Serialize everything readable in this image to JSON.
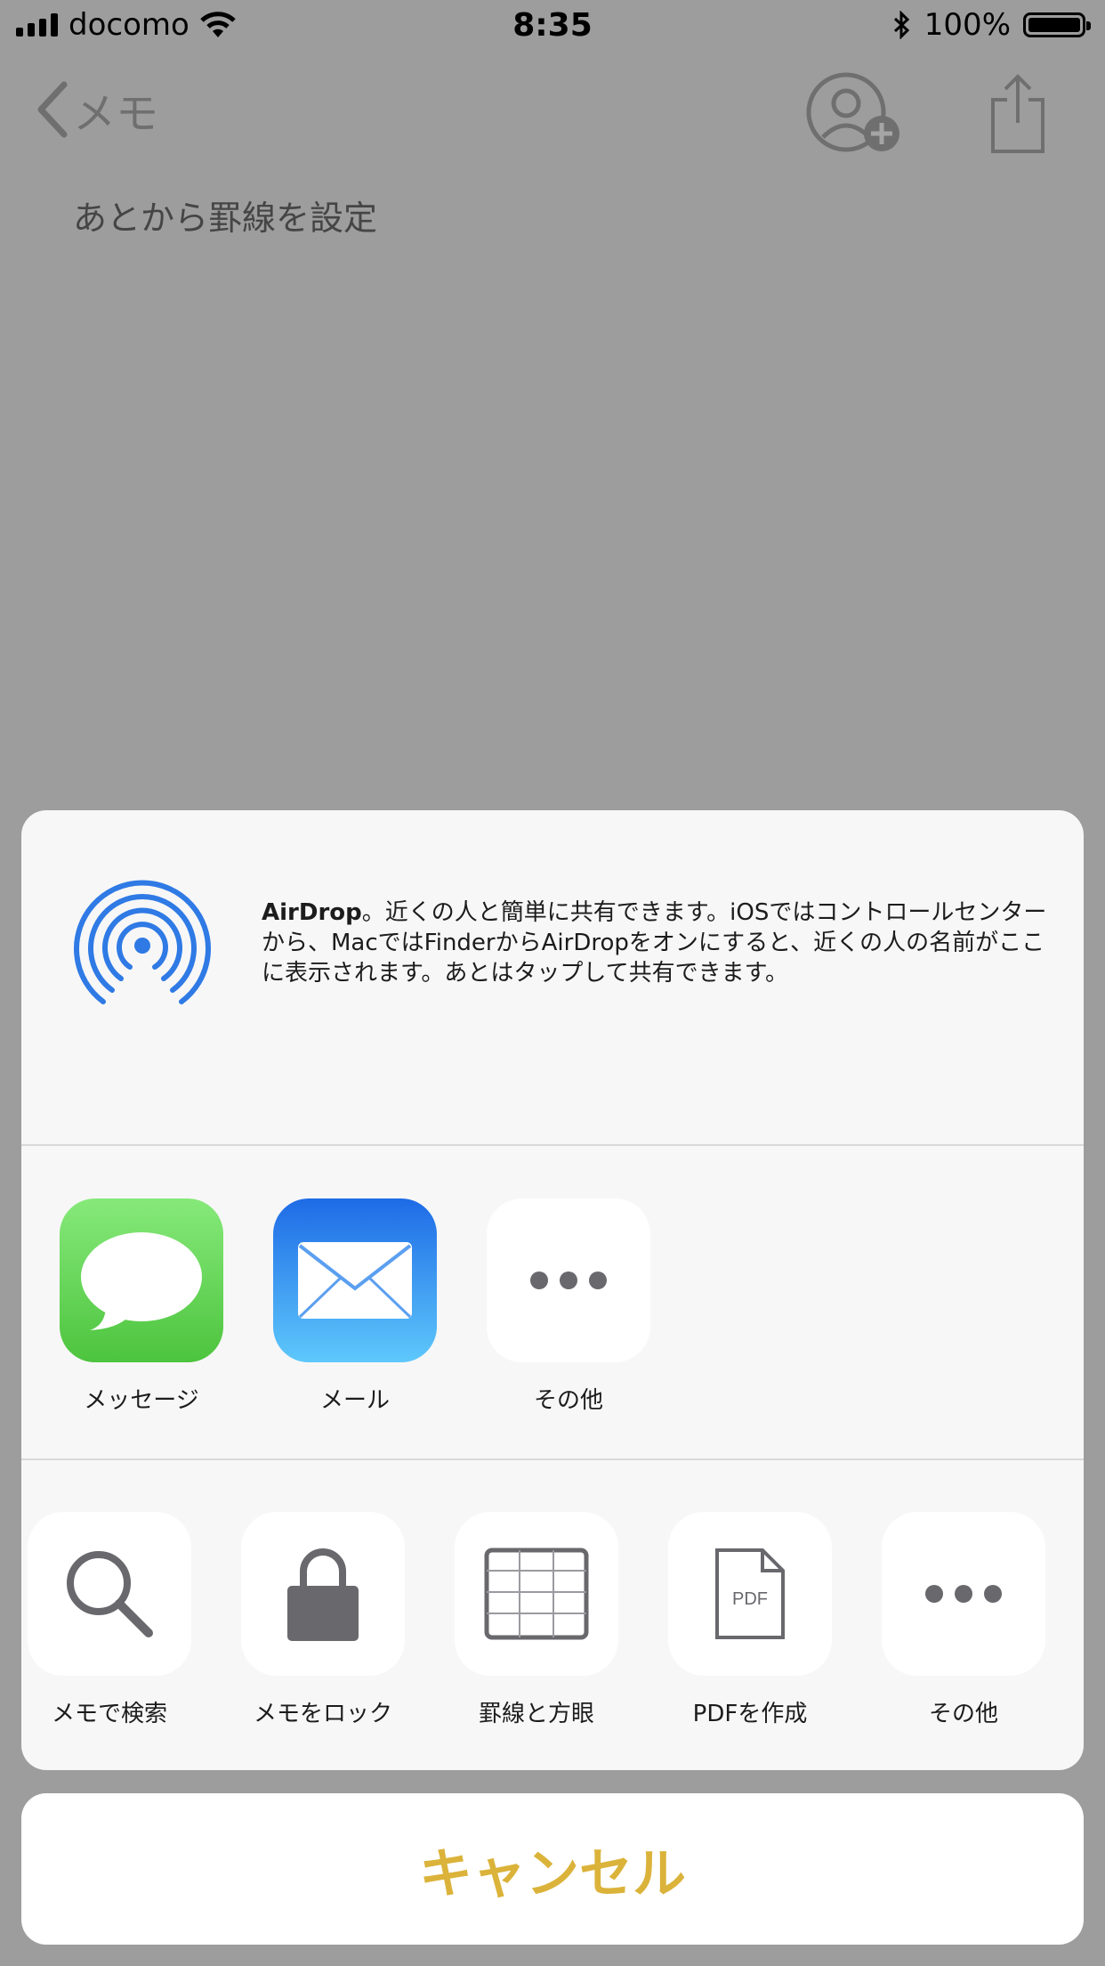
{
  "status_bar": {
    "carrier": "docomo",
    "time": "8:35",
    "battery": "100%"
  },
  "nav": {
    "back_label": "メモ"
  },
  "note": {
    "text": "あとから罫線を設定"
  },
  "airdrop": {
    "title": "AirDrop",
    "description": "。近くの人と簡単に共有できます。iOSではコントロールセンターから、MacではFinderからAirDropをオンにすると、近くの人の名前がここに表示されます。あとはタップして共有できます。"
  },
  "apps": [
    {
      "label": "メッセージ",
      "icon": "messages-icon"
    },
    {
      "label": "メール",
      "icon": "mail-icon"
    },
    {
      "label": "その他",
      "icon": "more-icon"
    }
  ],
  "actions": [
    {
      "label": "メモで検索",
      "icon": "search-icon"
    },
    {
      "label": "メモをロック",
      "icon": "lock-icon"
    },
    {
      "label": "罫線と方眼",
      "icon": "grid-icon"
    },
    {
      "label": "PDFを作成",
      "icon": "pdf-icon",
      "badge": "PDF"
    },
    {
      "label": "その他",
      "icon": "more-icon"
    }
  ],
  "cancel_label": "キャンセル",
  "colors": {
    "accent": "#dbb33a",
    "airdrop_blue": "#2f7ae5",
    "icon_gray": "#68686d"
  }
}
